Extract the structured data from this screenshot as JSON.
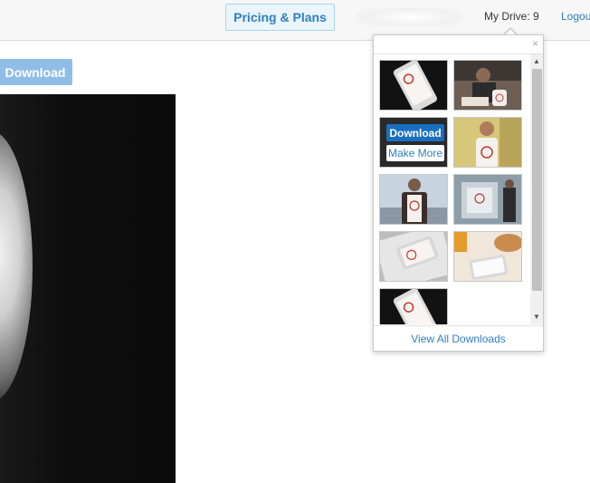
{
  "header": {
    "pricing_label": "Pricing & Plans",
    "my_drive_label": "My Drive: 9",
    "logout_label": "Logou"
  },
  "main": {
    "download_label": "Download"
  },
  "popup": {
    "close_glyph": "×",
    "overlay_download_label": "Download",
    "overlay_make_more_label": "Make More",
    "view_all_label": "View All Downloads",
    "scroll_up_glyph": "▲",
    "scroll_down_glyph": "▼"
  },
  "colors": {
    "accent": "#2f7fc1",
    "download_button": "#8fbde6",
    "overlay_download": "#1a6fc1"
  }
}
